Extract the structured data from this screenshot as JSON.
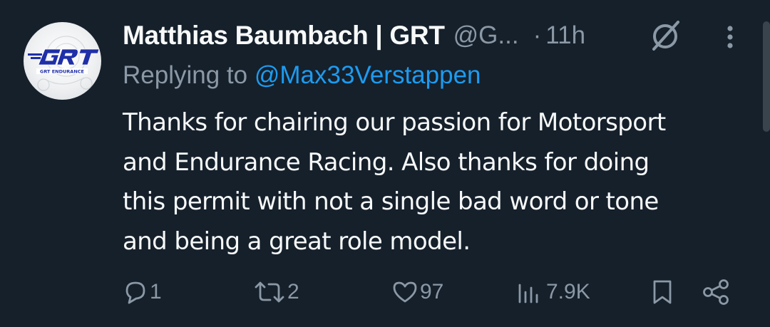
{
  "tweet": {
    "author_name": "Matthias Baumbach | GRT",
    "handle": "@G...",
    "separator": "·",
    "time": "11h",
    "replying_prefix": "Replying to ",
    "replying_to": "@Max33Verstappen",
    "body_lines": [
      "Thanks for chairing our passion for Motorsport",
      "and Endurance Racing. Also thanks for doing",
      "this permit with not a single bad word or tone",
      "and being a great role model."
    ],
    "avatar": {
      "logo_text": "GRT",
      "sub_text": "GRT ENDURANCE"
    }
  },
  "actions": {
    "replies": "1",
    "reposts": "2",
    "likes": "97",
    "views": "7.9K"
  },
  "colors": {
    "background": "#15202b",
    "text_primary": "#f7f9f9",
    "text_secondary": "#8b98a5",
    "accent": "#1d9bf0",
    "logo_blue": "#1f2fa8"
  },
  "icons": {
    "mute": "mute-icon",
    "more": "more-icon",
    "reply": "reply-icon",
    "repost": "repost-icon",
    "like": "heart-icon",
    "views": "views-icon",
    "bookmark": "bookmark-icon",
    "share": "share-icon"
  }
}
